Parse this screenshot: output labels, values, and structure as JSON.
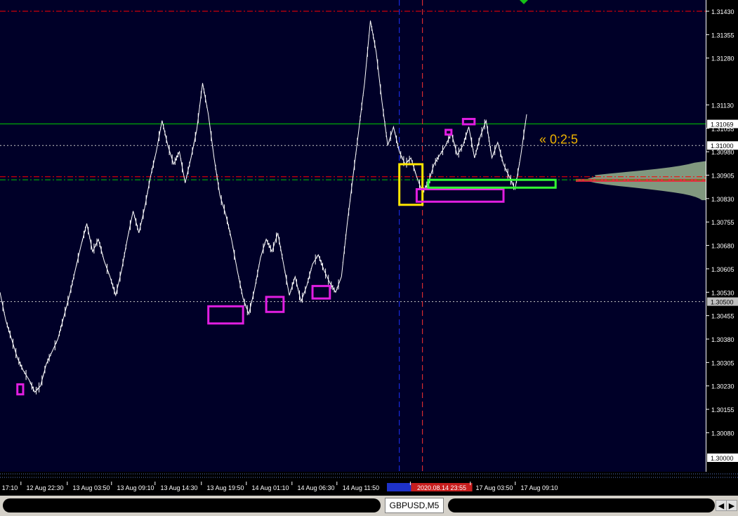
{
  "chart_data": {
    "type": "line",
    "symbol": "GBPUSD,M5",
    "y_axis": {
      "ylim": [
        1.29955,
        1.31466
      ],
      "ticks": [
        1.3143,
        1.31355,
        1.3128,
        1.3113,
        1.31055,
        1.3098,
        1.30905,
        1.3083,
        1.30755,
        1.3068,
        1.30605,
        1.3053,
        1.30455,
        1.3038,
        1.30305,
        1.3023,
        1.30155,
        1.3008
      ],
      "tick_labels": [
        "1.31430",
        "1.31355",
        "1.31280",
        "1.31130",
        "1.31055",
        "1.30980",
        "1.30905",
        "1.30830",
        "1.30755",
        "1.30680",
        "1.30605",
        "1.30530",
        "1.30455",
        "1.30380",
        "1.30305",
        "1.30230",
        "1.30155",
        "1.30080"
      ],
      "price_labels": [
        {
          "value": 1.31069,
          "text": "1.31069",
          "bg": "#ffffff",
          "fg": "#000000"
        },
        {
          "value": 1.31,
          "text": "1.31000",
          "bg": "#ffffff",
          "fg": "#000000"
        },
        {
          "value": 1.305,
          "text": "1.30500",
          "bg": "#c0c0c0",
          "fg": "#000000"
        },
        {
          "value": 1.3,
          "text": "1.30000",
          "bg": "#ffffff",
          "fg": "#000000"
        }
      ]
    },
    "x_axis": {
      "tick_labels": [
        "17:10",
        "12 Aug 22:30",
        "13 Aug 03:50",
        "13 Aug 09:10",
        "13 Aug 14:30",
        "13 Aug 19:50",
        "14 Aug 01:10",
        "14 Aug 06:30",
        "14 Aug 11:50",
        "2020.08.14 23:55",
        "17 Aug 03:50",
        "17 Aug 09:10"
      ],
      "highlighted": [
        {
          "text": "2020.08.14 23:55",
          "color": "#c81e1e"
        }
      ]
    },
    "series": [
      {
        "color": "#ffffff",
        "values": [
          1.3053,
          1.3044,
          1.3038,
          1.3032,
          1.3028,
          1.3025,
          1.3021,
          1.3023,
          1.303,
          1.3034,
          1.3038,
          1.3045,
          1.3052,
          1.306,
          1.3068,
          1.3075,
          1.3066,
          1.307,
          1.3063,
          1.3058,
          1.3052,
          1.306,
          1.307,
          1.3079,
          1.3072,
          1.308,
          1.309,
          1.3098,
          1.3108,
          1.31,
          1.3094,
          1.3098,
          1.3088,
          1.3096,
          1.3105,
          1.312,
          1.311,
          1.3096,
          1.3084,
          1.3078,
          1.307,
          1.306,
          1.3051,
          1.3046,
          1.3054,
          1.3064,
          1.307,
          1.3066,
          1.3072,
          1.3062,
          1.3052,
          1.3058,
          1.305,
          1.3055,
          1.3062,
          1.3065,
          1.306,
          1.3056,
          1.3053,
          1.3058,
          1.3075,
          1.309,
          1.3105,
          1.312,
          1.314,
          1.313,
          1.3114,
          1.31,
          1.3106,
          1.3098,
          1.3094,
          1.3096,
          1.309,
          1.3085,
          1.3088,
          1.3094,
          1.3097,
          1.31,
          1.3104,
          1.3097,
          1.31,
          1.3106,
          1.3096,
          1.3103,
          1.3108,
          1.3096,
          1.3101,
          1.3094,
          1.309,
          1.3086,
          1.3097,
          1.311
        ]
      }
    ],
    "horizontal_lines": [
      {
        "value": 1.3143,
        "color": "#ff0000",
        "style": "dashdot"
      },
      {
        "value": 1.31069,
        "color": "#00c800",
        "style": "solid"
      },
      {
        "value": 1.31,
        "color": "#c8c8c8",
        "style": "dotted"
      },
      {
        "value": 1.309,
        "color": "#ff0000",
        "style": "dashdot"
      },
      {
        "value": 1.3089,
        "color": "#00c800",
        "style": "dashdot"
      },
      {
        "value": 1.305,
        "color": "#c8c8c8",
        "style": "dotted"
      }
    ],
    "vertical_lines": [
      {
        "at_bar": 69,
        "color": "#1e32ff",
        "style": "dashed"
      },
      {
        "at_bar": 73,
        "color": "#ff3232",
        "style": "dashed"
      }
    ],
    "zones": [
      {
        "color": "#e11ee1",
        "bar_from": 3,
        "bar_to": 4,
        "price_top": 1.30235,
        "price_bottom": 1.30203
      },
      {
        "color": "#e11ee1",
        "bar_from": 36,
        "bar_to": 42,
        "price_top": 1.30485,
        "price_bottom": 1.3043
      },
      {
        "color": "#e11ee1",
        "bar_from": 46,
        "bar_to": 49,
        "price_top": 1.30515,
        "price_bottom": 1.30467
      },
      {
        "color": "#e11ee1",
        "bar_from": 54,
        "bar_to": 57,
        "price_top": 1.3055,
        "price_bottom": 1.3051
      },
      {
        "color": "#ffe600",
        "bar_from": 69,
        "bar_to": 73,
        "price_top": 1.3094,
        "price_bottom": 1.3081
      },
      {
        "color": "#e11ee1",
        "bar_from": 72,
        "bar_to": 87,
        "price_top": 1.3086,
        "price_bottom": 1.3082
      },
      {
        "color": "#32ff32",
        "bar_from": 74,
        "bar_to": 96,
        "price_top": 1.3089,
        "price_bottom": 1.30865
      },
      {
        "color": "#e11ee1",
        "bar_from": 77,
        "bar_to": 78,
        "price_top": 1.3105,
        "price_bottom": 1.31035
      },
      {
        "color": "#e11ee1",
        "bar_from": 80,
        "bar_to": 82,
        "price_top": 1.31085,
        "price_bottom": 1.31068
      }
    ],
    "annotation": {
      "text": "« 0:2:5",
      "color": "#f0b400",
      "price": 1.3102
    },
    "volume_profile": {
      "color": "#8fa888",
      "poc_color": "#e6283c"
    },
    "grid": false
  }
}
